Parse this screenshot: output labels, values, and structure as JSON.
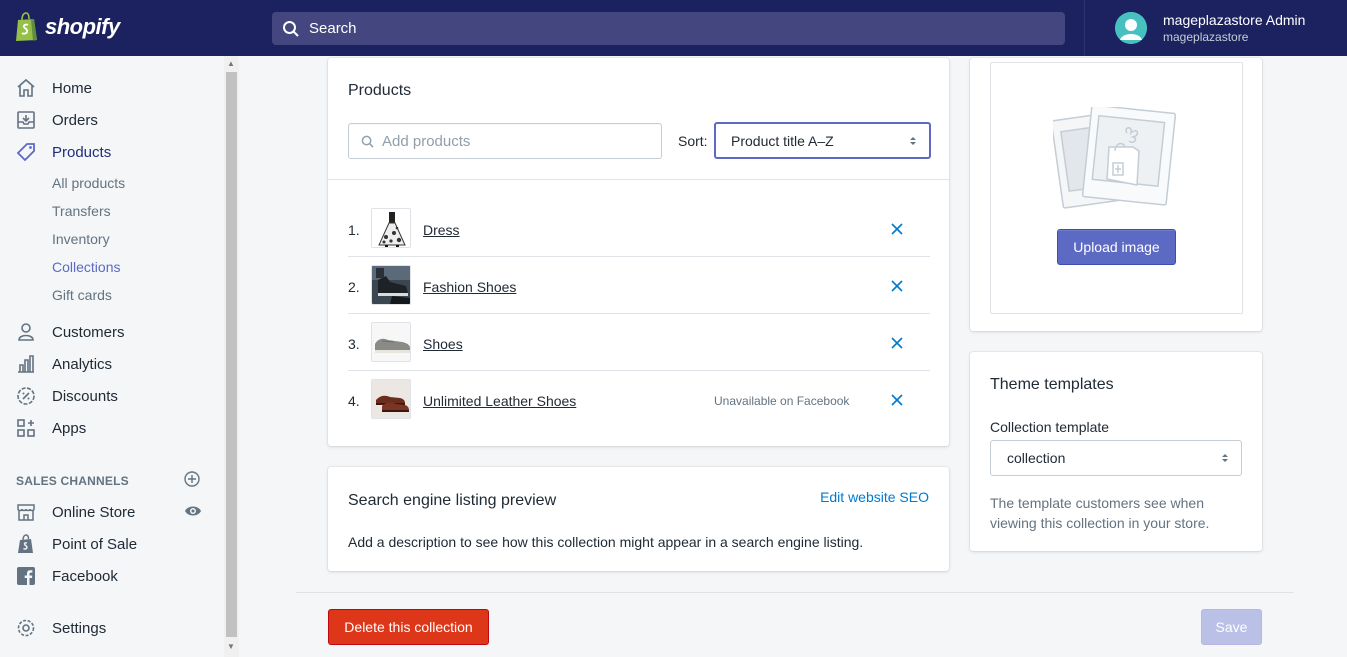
{
  "topbar": {
    "brand": "shopify",
    "search_placeholder": "Search",
    "account_name": "mageplazastore Admin",
    "account_store": "mageplazastore"
  },
  "sidebar": {
    "items": [
      {
        "label": "Home",
        "icon": "home-icon"
      },
      {
        "label": "Orders",
        "icon": "orders-icon"
      },
      {
        "label": "Products",
        "icon": "tag-icon"
      },
      {
        "label": "Customers",
        "icon": "person-icon"
      },
      {
        "label": "Analytics",
        "icon": "bar-chart-icon"
      },
      {
        "label": "Discounts",
        "icon": "discount-icon"
      },
      {
        "label": "Apps",
        "icon": "apps-icon"
      }
    ],
    "product_subitems": [
      "All products",
      "Transfers",
      "Inventory",
      "Collections",
      "Gift cards"
    ],
    "active_subitem": "Collections",
    "sales_channels_heading": "SALES CHANNELS",
    "channels": [
      {
        "label": "Online Store",
        "icon": "store-icon"
      },
      {
        "label": "Point of Sale",
        "icon": "shopify-bag-icon"
      },
      {
        "label": "Facebook",
        "icon": "facebook-icon"
      }
    ],
    "settings_label": "Settings"
  },
  "products_card": {
    "title": "Products",
    "search_placeholder": "Add products",
    "sort_label": "Sort:",
    "sort_value": "Product title A–Z",
    "rows": [
      {
        "num": "1.",
        "name": "Dress",
        "note": ""
      },
      {
        "num": "2.",
        "name": "Fashion Shoes",
        "note": ""
      },
      {
        "num": "3.",
        "name": "Shoes",
        "note": ""
      },
      {
        "num": "4.",
        "name": "Unlimited Leather Shoes",
        "note": "Unavailable on Facebook"
      }
    ]
  },
  "seo_card": {
    "title": "Search engine listing preview",
    "link": "Edit website SEO",
    "text": "Add a description to see how this collection might appear in a search engine listing."
  },
  "image_card": {
    "button": "Upload image"
  },
  "theme_card": {
    "title": "Theme templates",
    "label": "Collection template",
    "value": "collection",
    "help": "The template customers see when viewing this collection in your store."
  },
  "footer": {
    "delete_label": "Delete this collection",
    "save_label": "Save"
  },
  "colors": {
    "topbar": "#1c2260",
    "accent": "#5c6ac4",
    "danger": "#de3618",
    "link": "#007ace"
  }
}
